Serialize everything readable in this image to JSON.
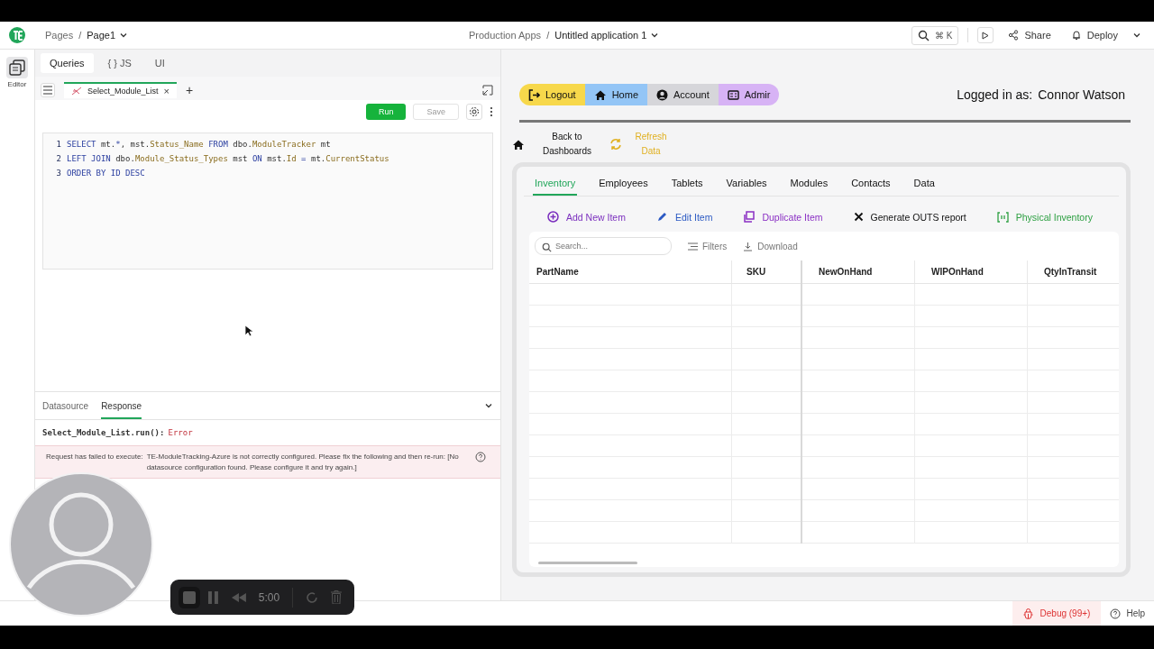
{
  "header": {
    "separator": "/",
    "breadcrumb_root": "Pages",
    "page": "Page1",
    "workspace": "Production Apps",
    "app": "Untitled application 1",
    "shortcut": "⌘ K",
    "share": "Share",
    "deploy": "Deploy"
  },
  "rail": {
    "editor": "Editor"
  },
  "panel_tabs": [
    {
      "label": "Queries",
      "selected": true
    },
    {
      "label": "{ } JS",
      "selected": false
    },
    {
      "label": "UI",
      "selected": false
    }
  ],
  "query_tab": {
    "name": "Select_Module_List",
    "close": "×",
    "add": "+"
  },
  "toolbar": {
    "run": "Run",
    "save": "Save"
  },
  "code": [
    {
      "number": "1",
      "tokens": [
        {
          "text": "SELECT",
          "kind": "kw"
        },
        {
          "text": " mt.",
          "kind": "id"
        },
        {
          "text": "*",
          "kind": "kw"
        },
        {
          "text": ", mst.",
          "kind": "id"
        },
        {
          "text": "Status_Name",
          "kind": "field"
        },
        {
          "text": " FROM",
          "kind": "kw"
        },
        {
          "text": " dbo.",
          "kind": "id"
        },
        {
          "text": "ModuleTracker",
          "kind": "field"
        },
        {
          "text": " mt",
          "kind": "id"
        }
      ]
    },
    {
      "number": "2",
      "tokens": [
        {
          "text": "LEFT JOIN",
          "kind": "kw"
        },
        {
          "text": " dbo.",
          "kind": "id"
        },
        {
          "text": "Module_Status_Types",
          "kind": "field"
        },
        {
          "text": " mst ",
          "kind": "id"
        },
        {
          "text": "ON",
          "kind": "kw"
        },
        {
          "text": " mst.",
          "kind": "id"
        },
        {
          "text": "Id",
          "kind": "field"
        },
        {
          "text": " = ",
          "kind": "kw"
        },
        {
          "text": "mt.",
          "kind": "id"
        },
        {
          "text": "CurrentStatus",
          "kind": "field"
        }
      ]
    },
    {
      "number": "3",
      "tokens": [
        {
          "text": "ORDER BY ID DESC",
          "kind": "kw"
        }
      ]
    }
  ],
  "response_tabs": [
    {
      "label": "Datasource",
      "selected": false
    },
    {
      "label": "Response",
      "selected": true
    }
  ],
  "result": {
    "call": "Select_Module_List.run():",
    "status": "Error",
    "message": "Request has failed to execute:",
    "detail": "TE-ModuleTracking-Azure is not correctly configured. Please fix the following and then re-run: [No datasource configuration found. Please configure it and try again.]"
  },
  "nav_buttons": [
    {
      "label": "Logout",
      "color": "#f7d84b"
    },
    {
      "label": "Home",
      "color": "#93c5f6"
    },
    {
      "label": "Account",
      "color": "#d6d6da"
    },
    {
      "label": "Admir",
      "color": "#d7b3f5"
    }
  ],
  "logged_in": {
    "label": "Logged in as:",
    "user": "Connor Watson"
  },
  "links": [
    {
      "label": "Back to Dashboards",
      "kind": "home"
    },
    {
      "label": "Refresh Data",
      "kind": "refresh"
    }
  ],
  "app_tabs": [
    {
      "label": "Inventory",
      "selected": true
    },
    {
      "label": "Employees",
      "selected": false
    },
    {
      "label": "Tablets",
      "selected": false
    },
    {
      "label": "Variables",
      "selected": false
    },
    {
      "label": "Modules",
      "selected": false
    },
    {
      "label": "Contacts",
      "selected": false
    },
    {
      "label": "Data",
      "selected": false
    }
  ],
  "actions": [
    {
      "label": "Add New Item",
      "kind": "add",
      "color": "#7b2fbe"
    },
    {
      "label": "Edit Item",
      "kind": "edit",
      "color": "#2b59c3"
    },
    {
      "label": "Duplicate Item",
      "kind": "duplicate",
      "color": "#8a2fc4"
    },
    {
      "label": "Generate OUTS report",
      "kind": "close",
      "color": "#111111"
    },
    {
      "label": "Physical Inventory",
      "kind": "scan",
      "color": "#2ea043"
    }
  ],
  "table": {
    "search_placeholder": "Search...",
    "filters": "Filters",
    "download": "Download",
    "columns": [
      "PartName",
      "SKU",
      "NewOnHand",
      "WIPOnHand",
      "QtyInTransit"
    ]
  },
  "recorder": {
    "time": "5:00"
  },
  "status_bar": {
    "debug": "Debug (99+)",
    "help": "Help"
  }
}
